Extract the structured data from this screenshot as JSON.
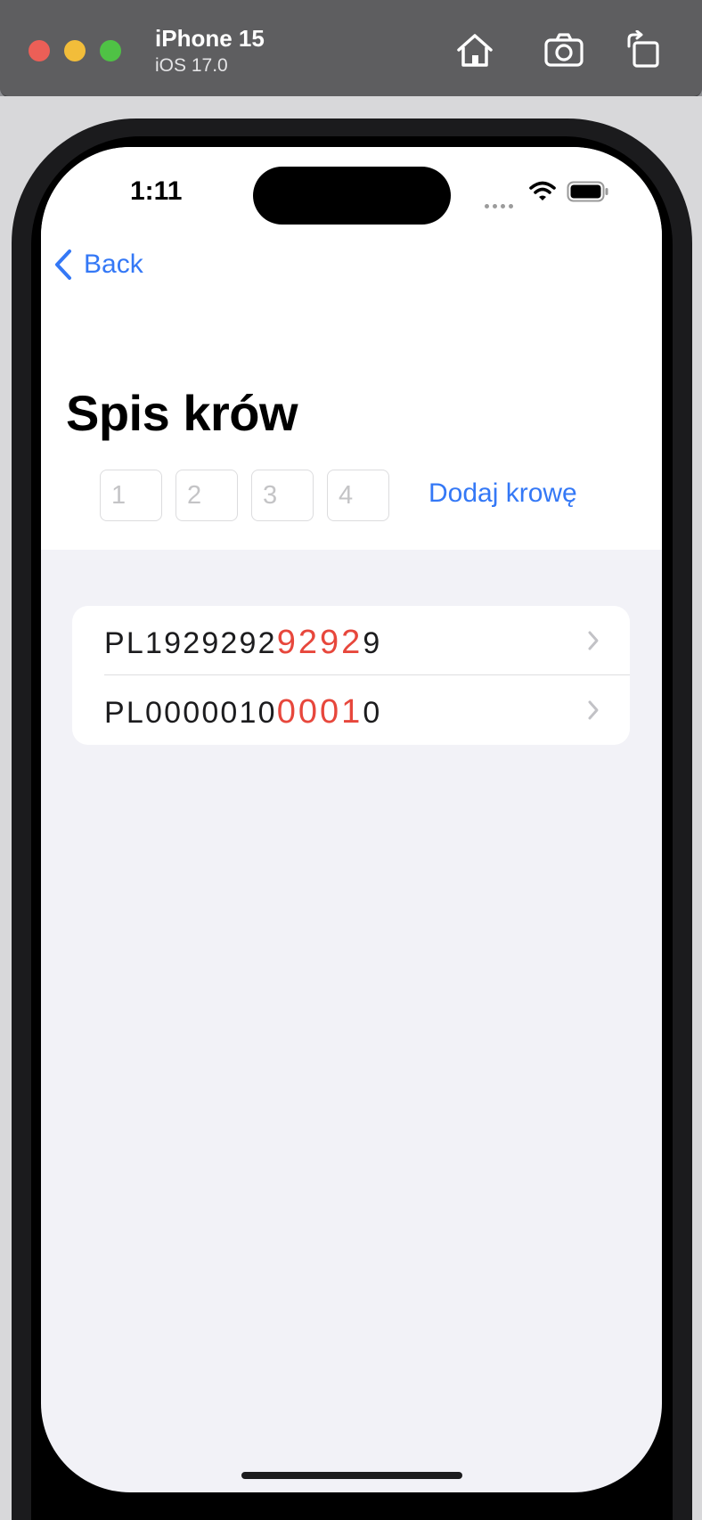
{
  "window": {
    "device_name": "iPhone 15",
    "os_version": "iOS 17.0",
    "tools": [
      "home-icon",
      "screenshot-icon",
      "rotate-icon"
    ]
  },
  "status_bar": {
    "time": "1:11"
  },
  "nav": {
    "back_label": "Back"
  },
  "page": {
    "title": "Spis krów"
  },
  "filter": {
    "digit_placeholders": [
      "1",
      "2",
      "3",
      "4"
    ],
    "add_button_label": "Dodaj krowę"
  },
  "cows": [
    {
      "prefix": "PL1929292",
      "highlight": "9292",
      "suffix": "9"
    },
    {
      "prefix": "PL0000010",
      "highlight": "0001",
      "suffix": "0"
    }
  ],
  "colors": {
    "accent": "#3478f6",
    "highlight": "#e7473c"
  }
}
